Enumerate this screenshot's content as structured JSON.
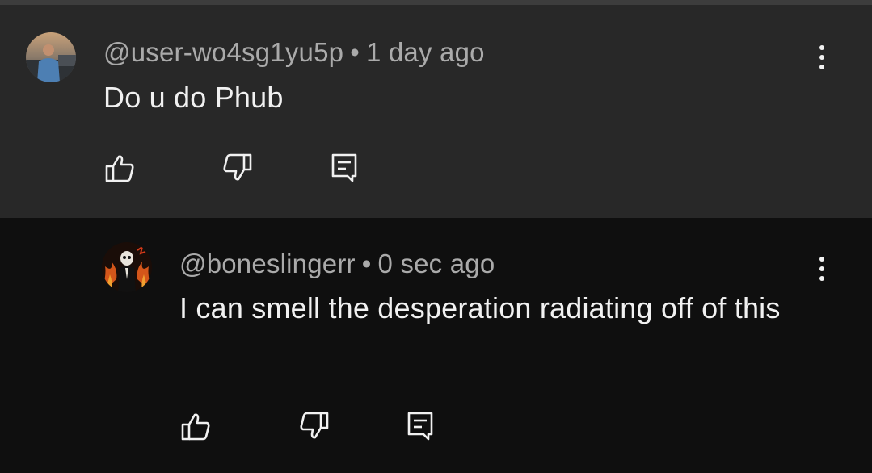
{
  "comments": [
    {
      "author": "@user-wo4sg1yu5p",
      "separator": "•",
      "time": "1 day ago",
      "text": "Do u do Phub",
      "avatar_icon": "user-photo-avatar",
      "menu_icon": "more-vertical-icon",
      "actions": [
        "like-icon",
        "dislike-icon",
        "reply-icon"
      ]
    },
    {
      "author": "@boneslingerr",
      "separator": "•",
      "time": "0 sec ago",
      "text": "I can smell the desperation radiating off of this",
      "avatar_icon": "skeleton-fire-avatar",
      "menu_icon": "more-vertical-icon",
      "actions": [
        "like-icon",
        "dislike-icon",
        "reply-icon"
      ]
    }
  ],
  "colors": {
    "parent_bg": "#282828",
    "reply_bg": "#0f0f0f",
    "meta_text": "#aaaaaa",
    "body_text": "#f1f1f1"
  }
}
